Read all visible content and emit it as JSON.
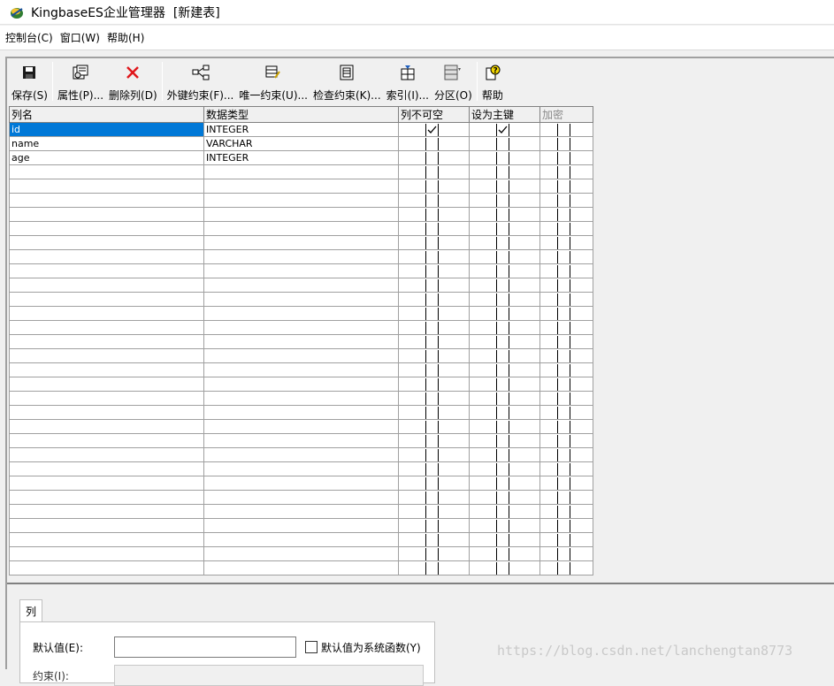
{
  "window": {
    "title": "KingbaseES企业管理器  [新建表]"
  },
  "menu": [
    "控制台(C)",
    "窗口(W)",
    "帮助(H)"
  ],
  "toolbar": {
    "save": "保存(S)",
    "properties": "属性(P)...",
    "delete_column": "删除列(D)",
    "foreign_key": "外键约束(F)...",
    "unique": "唯一约束(U)...",
    "check": "检查约束(K)...",
    "index": "索引(I)...",
    "partition": "分区(O)",
    "help": "帮助"
  },
  "grid": {
    "headers": [
      "列名",
      "数据类型",
      "列不可空",
      "设为主键",
      "加密"
    ],
    "rows": [
      {
        "name": "id",
        "type": "INTEGER",
        "not_null": true,
        "primary_key": true,
        "encrypt": false
      },
      {
        "name": "name",
        "type": "VARCHAR",
        "not_null": false,
        "primary_key": false,
        "encrypt": false
      },
      {
        "name": "age",
        "type": "INTEGER",
        "not_null": false,
        "primary_key": false,
        "encrypt": false
      }
    ],
    "selected_row": 0
  },
  "bottom": {
    "tab": "列",
    "default_label": "默认值(E):",
    "default_value": "",
    "sys_func_label": "默认值为系统函数(Y)",
    "sys_func_checked": false,
    "second_label": "约束(I):"
  },
  "watermark": "https://blog.csdn.net/lanchengtan8773"
}
